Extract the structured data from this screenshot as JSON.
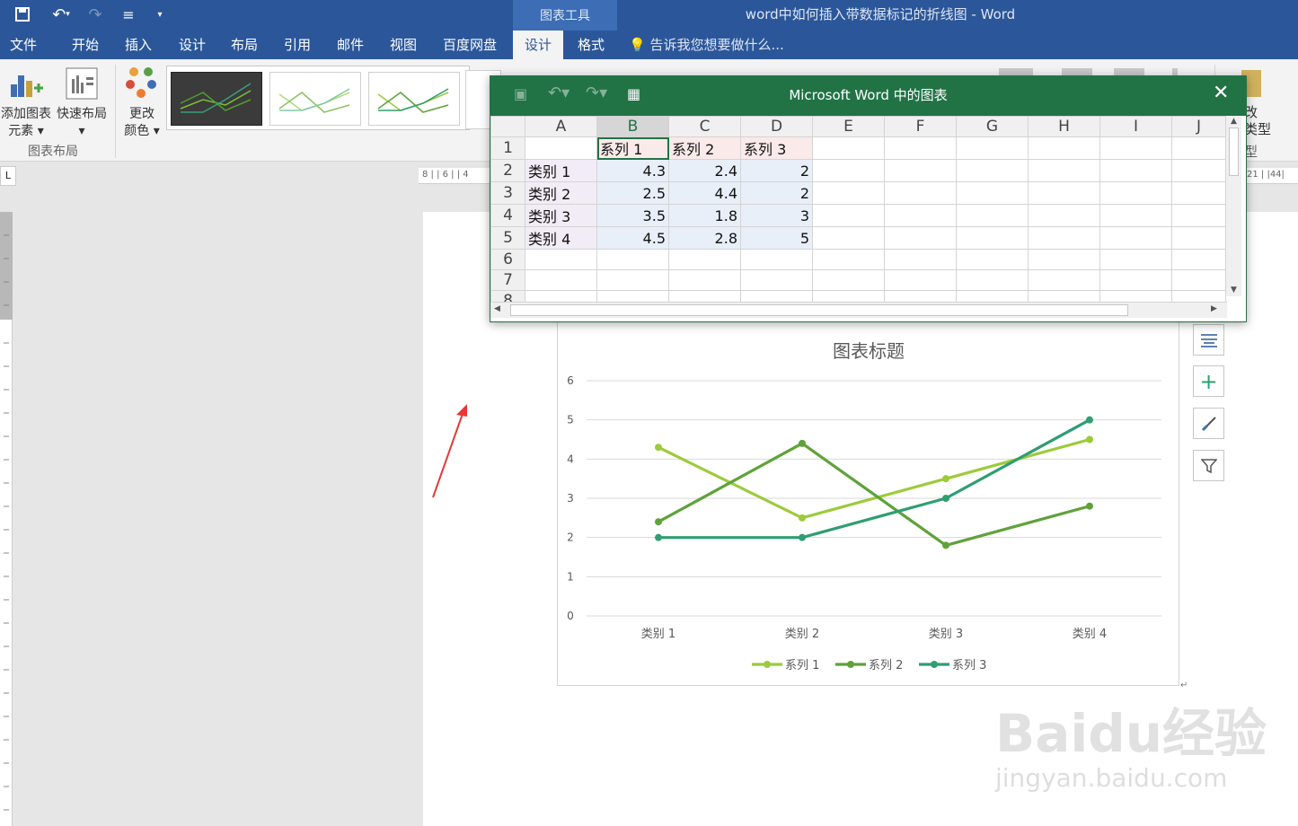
{
  "window": {
    "title": "word中如何插入带数据标记的折线图 - Word",
    "context_tab": "图表工具"
  },
  "tabs": [
    "文件",
    "开始",
    "插入",
    "设计",
    "布局",
    "引用",
    "邮件",
    "视图",
    "百度网盘",
    "设计",
    "格式"
  ],
  "tell_me": "告诉我您想要做什么...",
  "ribbon": {
    "add_element_l1": "添加图表",
    "add_element_l2": "元素",
    "quick_layout": "快速布局",
    "change_color_l1": "更改",
    "change_color_l2": "颜色",
    "group_layout": "图表布局",
    "right_l1": "改",
    "right_l2": "类型",
    "right_l3": "型"
  },
  "excel": {
    "title": "Microsoft Word 中的图表",
    "columns": [
      "A",
      "B",
      "C",
      "D",
      "E",
      "F",
      "G",
      "H",
      "I",
      "J"
    ],
    "rows": [
      [
        "",
        "系列 1",
        "系列 2",
        "系列 3"
      ],
      [
        "类别 1",
        "4.3",
        "2.4",
        "2"
      ],
      [
        "类别 2",
        "2.5",
        "4.4",
        "2"
      ],
      [
        "类别 3",
        "3.5",
        "1.8",
        "3"
      ],
      [
        "类别 4",
        "4.5",
        "2.8",
        "5"
      ],
      [
        "",
        "",
        "",
        ""
      ],
      [
        "",
        "",
        "",
        ""
      ],
      [
        "",
        "",
        "",
        ""
      ]
    ],
    "row_numbers": [
      "1",
      "2",
      "3",
      "4",
      "5",
      "6",
      "7",
      "8"
    ]
  },
  "chart_data": {
    "type": "line",
    "title": "图表标题",
    "categories": [
      "类别 1",
      "类别 2",
      "类别 3",
      "类别 4"
    ],
    "series": [
      {
        "name": "系列 1",
        "values": [
          4.3,
          2.5,
          3.5,
          4.5
        ],
        "color": "#9ccb3b"
      },
      {
        "name": "系列 2",
        "values": [
          2.4,
          4.4,
          1.8,
          2.8
        ],
        "color": "#5fa23a"
      },
      {
        "name": "系列 3",
        "values": [
          2,
          2,
          3,
          5
        ],
        "color": "#2f9e72"
      }
    ],
    "ylim": [
      0,
      6
    ],
    "yticks": [
      "0",
      "1",
      "2",
      "3",
      "4",
      "5",
      "6"
    ],
    "markers": true,
    "grid": true,
    "legend": "bottom"
  },
  "ruler": {
    "h_marks": "8 | | 6 | | 4",
    "h_right": "21 | |44|"
  },
  "watermark": {
    "brand": "Baidu经验",
    "url": "jingyan.baidu.com"
  }
}
